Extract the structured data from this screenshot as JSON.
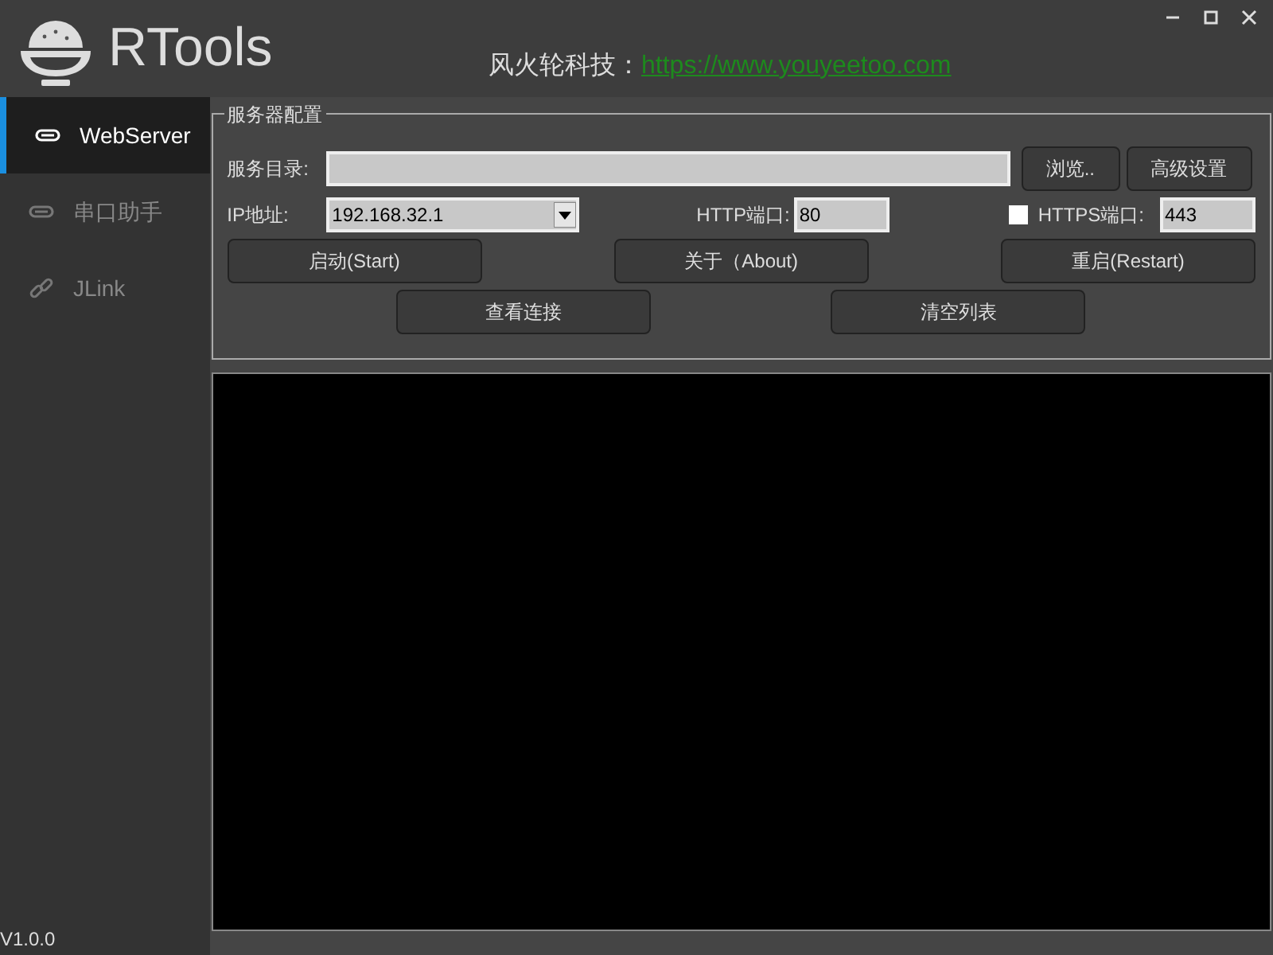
{
  "window": {
    "title": "RTools",
    "buttons": [
      {
        "kind": "minimize"
      },
      {
        "kind": "maximize"
      },
      {
        "kind": "close"
      }
    ]
  },
  "header": {
    "company": "风火轮科技：",
    "link": "https://www.youyeetoo.com"
  },
  "sidebar": {
    "items": [
      {
        "label": "WebServer",
        "kind": "pill",
        "selected": true
      },
      {
        "label": "串口助手",
        "kind": "pill",
        "selected": false
      },
      {
        "label": "JLink",
        "kind": "link",
        "selected": false
      }
    ],
    "version": "V1.0.0"
  },
  "config": {
    "title": "服务器配置",
    "dir_label": "服务目录:",
    "browse": "浏览..",
    "advanced": "高级设置",
    "ip_label": "IP地址:",
    "ip_value": "192.168.32.1",
    "http_label": "HTTP端口:",
    "http_value": "80",
    "https_checked": false,
    "https_label": "HTTPS端口:",
    "https_value": "443",
    "row1": [
      "启动(Start)",
      "关于（About)",
      "重启(Restart)"
    ],
    "row2": [
      "查看连接",
      "清空列表"
    ]
  }
}
